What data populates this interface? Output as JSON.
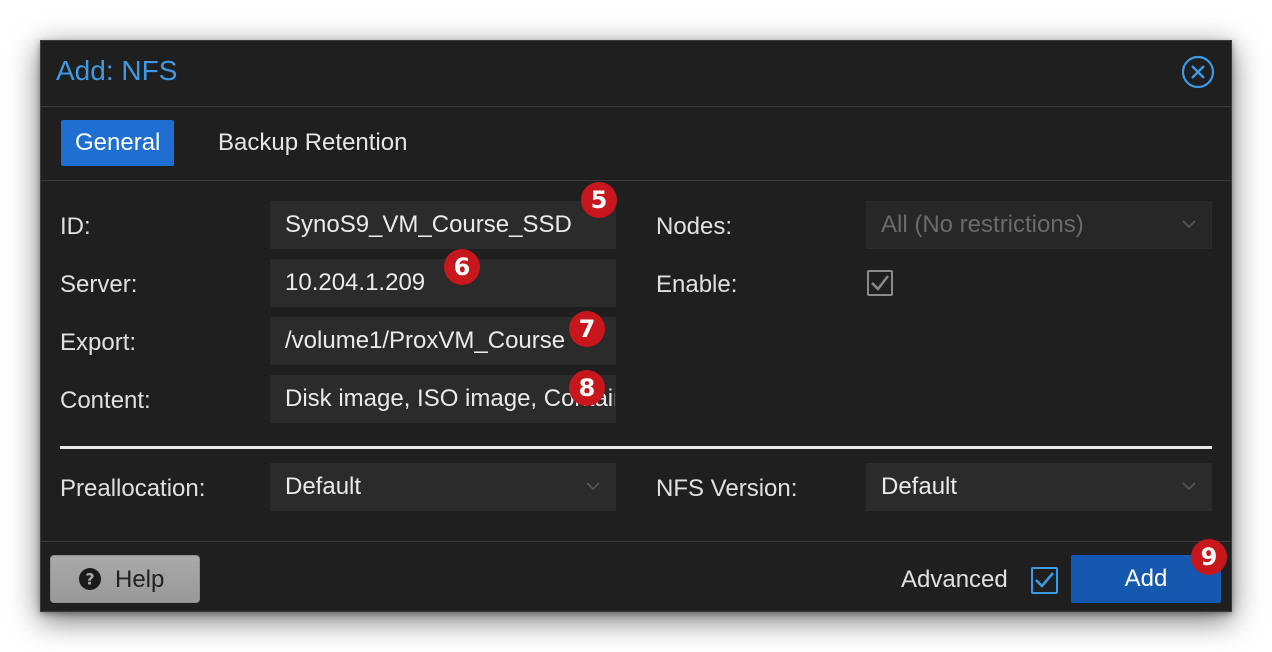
{
  "dialog": {
    "title": "Add: NFS",
    "close_icon": "close-circle-icon",
    "accent_color": "#3f9ae6"
  },
  "tabs": [
    {
      "label": "General",
      "active": true
    },
    {
      "label": "Backup Retention",
      "active": false
    }
  ],
  "form": {
    "id_label": "ID:",
    "id_value": "SynoS9_VM_Course_SSD",
    "server_label": "Server:",
    "server_value": "10.204.1.209",
    "export_label": "Export:",
    "export_value": "/volume1/ProxVM_Course",
    "content_label": "Content:",
    "content_value": "Disk image, ISO image, Container template, VZDump backup file",
    "nodes_label": "Nodes:",
    "nodes_value": "All (No restrictions)",
    "enable_label": "Enable:",
    "enable_checked": true,
    "preallocation_label": "Preallocation:",
    "preallocation_value": "Default",
    "nfs_version_label": "NFS Version:",
    "nfs_version_value": "Default"
  },
  "footer": {
    "help_label": "Help",
    "help_icon": "question-circle-icon",
    "advanced_label": "Advanced",
    "advanced_checked": true,
    "add_label": "Add"
  },
  "annotations": {
    "badge_5": "5",
    "badge_6": "6",
    "badge_7": "7",
    "badge_8": "8",
    "badge_9": "9",
    "badge_color": "#c8161d"
  }
}
